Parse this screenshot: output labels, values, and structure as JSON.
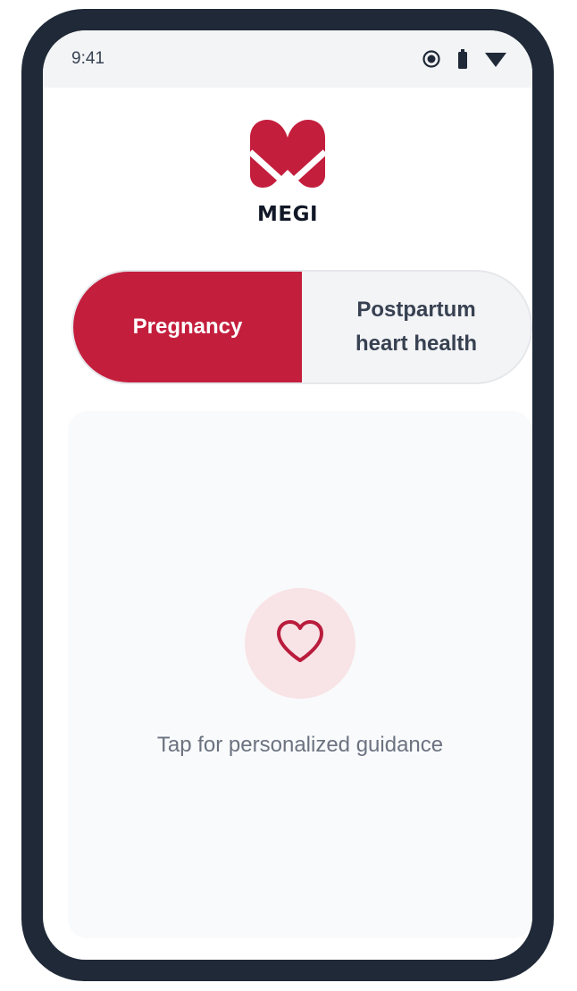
{
  "status_bar": {
    "time": "9:41",
    "icons": [
      "dnd-icon",
      "battery-icon",
      "wifi-icon"
    ]
  },
  "app": {
    "logo_text": "MEGI",
    "brand_color": "#c41e3d"
  },
  "mode_toggle": {
    "options": [
      {
        "label": "Pregnancy",
        "selected": true
      },
      {
        "label_line1": "Postpartum",
        "label_line2": "heart health",
        "selected": false
      }
    ]
  },
  "guidance_card": {
    "icon": "heart-outline-icon",
    "caption": "Tap for personalized guidance"
  }
}
